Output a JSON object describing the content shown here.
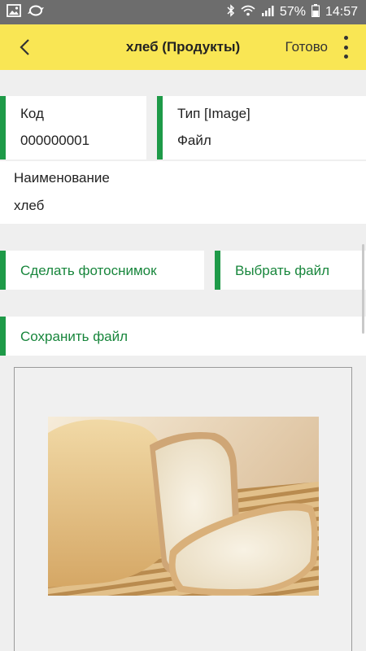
{
  "status_bar": {
    "battery": "57%",
    "time": "14:57"
  },
  "app_bar": {
    "title": "хлеб (Продукты)",
    "done_label": "Готово"
  },
  "fields": {
    "code": {
      "label": "Код",
      "value": "000000001"
    },
    "type": {
      "label": "Тип [Image]",
      "value": "Файл"
    },
    "name": {
      "label": "Наименование",
      "value": "хлеб"
    }
  },
  "buttons": {
    "take_photo": "Сделать фотоснимок",
    "choose_file": "Выбрать файл",
    "save_file": "Сохранить файл"
  },
  "icons": {
    "back": "arrow-left-icon",
    "more": "more-vertical-icon",
    "gallery": "image-icon",
    "sync": "sync-icon",
    "bluetooth": "bluetooth-icon",
    "wifi": "wifi-icon",
    "signal": "signal-icon",
    "battery": "battery-icon"
  },
  "colors": {
    "app_bar": "#f9e654",
    "accent": "#1e9a48",
    "button_text": "#18863c"
  }
}
